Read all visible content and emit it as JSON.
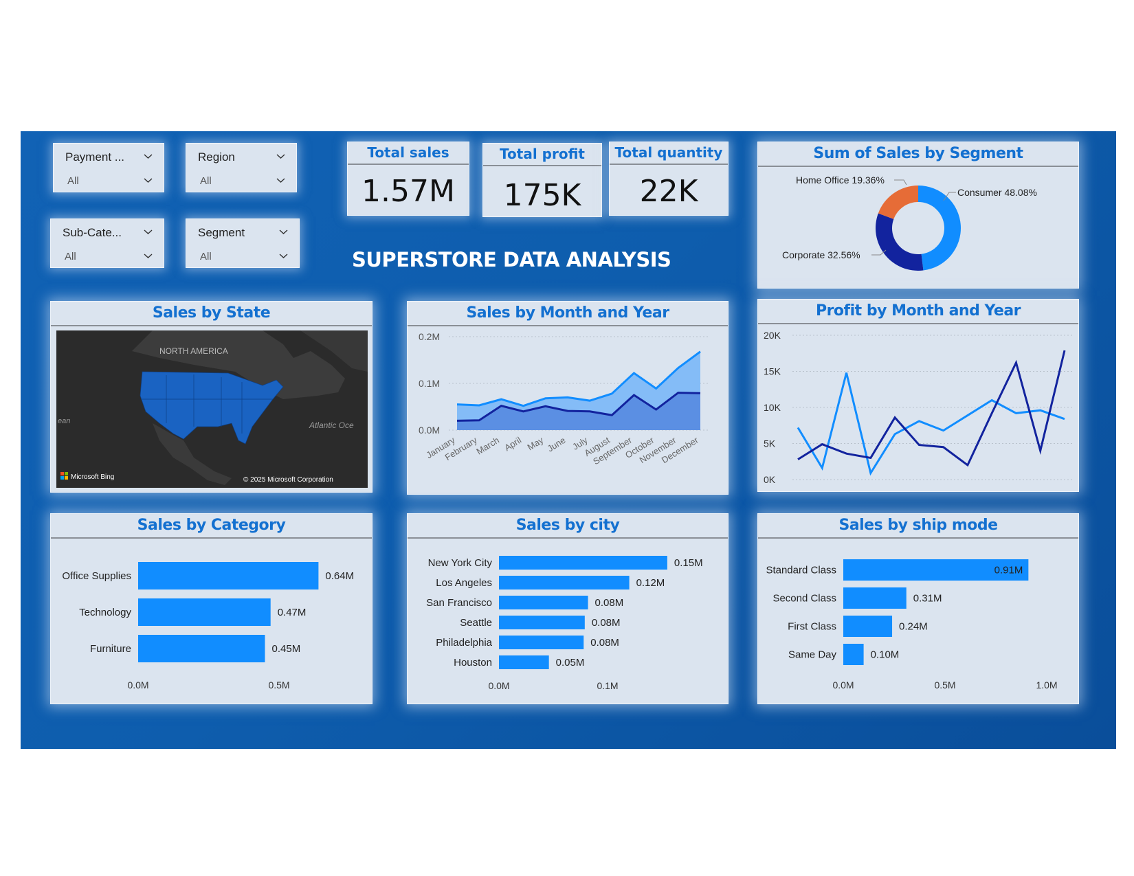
{
  "title": "SUPERSTORE DATA ANALYSIS",
  "slicers": [
    {
      "label": "Payment ...",
      "value": "All"
    },
    {
      "label": "Region",
      "value": "All"
    },
    {
      "label": "Sub-Cate...",
      "value": "All"
    },
    {
      "label": "Segment",
      "value": "All"
    }
  ],
  "kpis": [
    {
      "title": "Total sales",
      "value": "1.57M"
    },
    {
      "title": "Total profit",
      "value": "175K"
    },
    {
      "title": "Total quantity",
      "value": "22K"
    }
  ],
  "segment_chart": {
    "title": "Sum of Sales by Segment",
    "labels": [
      "Consumer 48.08%",
      "Corporate 32.56%",
      "Home Office 19.36%"
    ]
  },
  "map": {
    "title": "Sales by State",
    "continent_label": "NORTH AMERICA",
    "ocean_label": "Atlantic Oce",
    "ocean_left_label": "ean",
    "brand": "Microsoft Bing",
    "copyright": "© 2025 Microsoft Corporation"
  },
  "colors": {
    "accent": "#1370d0",
    "bar": "#118dff",
    "dark_series": "#12239e",
    "light_series": "#118dff",
    "home_office": "#e66c37",
    "panel_bg": "#dbe4ef"
  },
  "chart_data": [
    {
      "id": "sales_month",
      "type": "area",
      "title": "Sales by Month and Year",
      "categories": [
        "January",
        "February",
        "March",
        "April",
        "May",
        "June",
        "July",
        "August",
        "September",
        "October",
        "November",
        "December"
      ],
      "series": [
        {
          "values": [
            0.055,
            0.053,
            0.066,
            0.052,
            0.068,
            0.07,
            0.063,
            0.078,
            0.122,
            0.089,
            0.133,
            0.168
          ]
        },
        {
          "values": [
            0.02,
            0.021,
            0.052,
            0.04,
            0.051,
            0.041,
            0.04,
            0.032,
            0.075,
            0.044,
            0.08,
            0.079
          ]
        }
      ],
      "yticks": [
        "0.0M",
        "0.1M",
        "0.2M"
      ],
      "ylim": [
        0,
        0.2
      ]
    },
    {
      "id": "profit_month",
      "type": "line",
      "title": "Profit by Month and Year",
      "series": [
        {
          "values": [
            7200,
            1600,
            14800,
            900,
            6300,
            8100,
            6800,
            8900,
            11000,
            9200,
            9600,
            8400
          ]
        },
        {
          "values": [
            2800,
            4900,
            3600,
            3000,
            8600,
            4800,
            4500,
            2000,
            9200,
            16200,
            4000,
            17900
          ]
        }
      ],
      "yticks": [
        "0K",
        "5K",
        "10K",
        "15K",
        "20K"
      ],
      "ylim": [
        0,
        20000
      ]
    },
    {
      "id": "category",
      "type": "bar",
      "title": "Sales by Category",
      "categories": [
        "Office Supplies",
        "Technology",
        "Furniture"
      ],
      "values": [
        0.64,
        0.47,
        0.45
      ],
      "labels": [
        "0.64M",
        "0.47M",
        "0.45M"
      ],
      "xticks": [
        "0.0M",
        "0.5M"
      ],
      "xlim": [
        0,
        0.5
      ]
    },
    {
      "id": "city",
      "type": "bar",
      "title": "Sales by city",
      "categories": [
        "New York City",
        "Los Angeles",
        "San Francisco",
        "Seattle",
        "Philadelphia",
        "Houston"
      ],
      "values": [
        0.155,
        0.12,
        0.082,
        0.079,
        0.078,
        0.046
      ],
      "labels": [
        "0.15M",
        "0.12M",
        "0.08M",
        "0.08M",
        "0.08M",
        "0.05M"
      ],
      "xticks": [
        "0.0M",
        "0.1M"
      ],
      "xlim": [
        0,
        0.1
      ]
    },
    {
      "id": "shipmode",
      "type": "bar",
      "title": "Sales by ship mode",
      "categories": [
        "Standard Class",
        "Second Class",
        "First Class",
        "Same Day"
      ],
      "values": [
        0.91,
        0.31,
        0.24,
        0.1
      ],
      "labels": [
        "0.91M",
        "0.31M",
        "0.24M",
        "0.10M"
      ],
      "xticks": [
        "0.0M",
        "0.5M",
        "1.0M"
      ],
      "xlim": [
        0,
        1.0
      ]
    },
    {
      "id": "segment",
      "type": "pie",
      "title": "Sum of Sales by Segment",
      "categories": [
        "Consumer",
        "Corporate",
        "Home Office"
      ],
      "values": [
        48.08,
        32.56,
        19.36
      ]
    }
  ]
}
